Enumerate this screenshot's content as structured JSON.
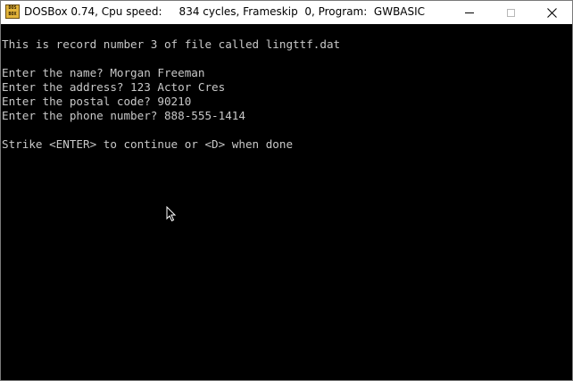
{
  "window": {
    "title": "DOSBox 0.74, Cpu speed:     834 cycles, Frameskip  0, Program:  GWBASIC",
    "icon_text_top": "DOS",
    "icon_text_bottom": "BOX",
    "icon": "dosbox-icon"
  },
  "console": {
    "lines": [
      "This is record number 3 of file called lingttf.dat",
      "",
      "Enter the name? Morgan Freeman",
      "Enter the address? 123 Actor Cres",
      "Enter the postal code? 90210",
      "Enter the phone number? 888-555-1414",
      "",
      "Strike <ENTER> to continue or <D> when done"
    ]
  },
  "colors": {
    "console_bg": "#000000",
    "console_text": "#c8c8c8",
    "titlebar_bg": "#ffffff"
  }
}
